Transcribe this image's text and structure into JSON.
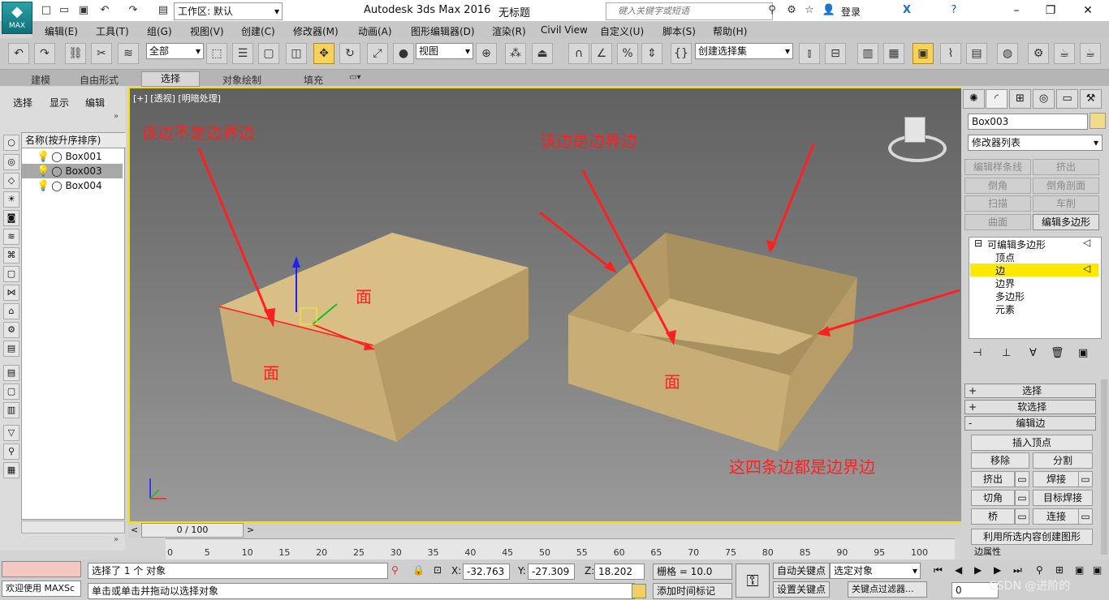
{
  "titlebar": {
    "logo_text": "MAX",
    "workspace": "工作区: 默认",
    "app_title": "Autodesk 3ds Max 2016",
    "doc_title": "无标题",
    "search_placeholder": "键入关键字或短语",
    "login": "登录"
  },
  "menus": [
    "编辑(E)",
    "工具(T)",
    "组(G)",
    "视图(V)",
    "创建(C)",
    "修改器(M)",
    "动画(A)",
    "图形编辑器(D)",
    "渲染(R)",
    "Civil View",
    "自定义(U)",
    "脚本(S)",
    "帮助(H)"
  ],
  "toolbar": {
    "filter": "全部",
    "refcoord": "视图",
    "selection_set": "创建选择集"
  },
  "ribbon_tabs": [
    "建模",
    "自由形式",
    "选择",
    "对象绘制",
    "填充"
  ],
  "explorer": {
    "tabs": [
      "选择",
      "显示",
      "编辑"
    ],
    "column_header": "名称(按升序排序)",
    "items": [
      "Box001",
      "Box003",
      "Box004"
    ]
  },
  "viewport": {
    "label": "[+] [透视] [明暗处理]",
    "annotations": {
      "not_border": "该边不是边界边",
      "is_border": "该边是边界边",
      "face_left": "面",
      "face_top": "面",
      "face_right": "面",
      "four_edges": "这四条边都是边界边"
    }
  },
  "timeline": {
    "frame": "0 / 100",
    "ticks": [
      "0",
      "5",
      "10",
      "15",
      "20",
      "25",
      "30",
      "35",
      "40",
      "45",
      "50",
      "55",
      "60",
      "65",
      "70",
      "75",
      "80",
      "85",
      "90",
      "95",
      "100"
    ]
  },
  "status": {
    "maxscript": "欢迎使用 MAXSc",
    "selected": "选择了 1 个 对象",
    "prompt": "单击或单击并拖动以选择对象",
    "x_label": "X:",
    "x": "-32.763",
    "y_label": "Y:",
    "y": "-27.309",
    "z_label": "Z:",
    "z": "18.202",
    "grid": "栅格 = 10.0",
    "autokey": "自动关键点",
    "setkey": "设置关键点",
    "sel_obj": "选定对象",
    "key_filter": "关键点过滤器...",
    "add_tag": "添加时间标记",
    "frame_value": "0",
    "watermark": "CSDN @进阶的"
  },
  "command": {
    "object_name": "Box003",
    "modifier_list": "修改器列表",
    "mod_buttons": [
      "编辑样条线",
      "挤出",
      "倒角",
      "倒角剖面",
      "扫描",
      "车削",
      "曲面",
      "编辑多边形"
    ],
    "stack": [
      "可编辑多边形",
      "顶点",
      "边",
      "边界",
      "多边形",
      "元素"
    ],
    "rollouts": [
      "选择",
      "软选择",
      "编辑边"
    ],
    "edit_edge": [
      "插入顶点",
      "移除",
      "分割",
      "挤出",
      "焊接",
      "切角",
      "目标焊接",
      "桥",
      "连接",
      "利用所选内容创建图形",
      "边属性"
    ]
  },
  "colors": {
    "accent": "#f5e100",
    "annotation": "#ff2020",
    "box_face": "#d9bf86",
    "highlight": "#ffe800"
  }
}
